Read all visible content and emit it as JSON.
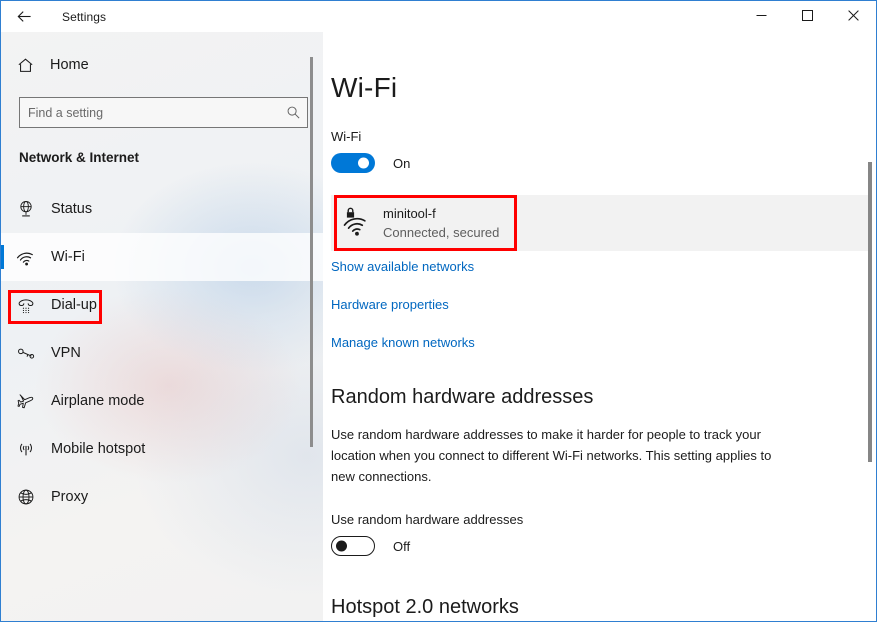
{
  "window": {
    "title": "Settings",
    "back_icon": "back-arrow-icon",
    "controls": {
      "minimize": "minimize-icon",
      "maximize": "maximize-icon",
      "close": "close-icon"
    },
    "border_color": "#2f7fd1"
  },
  "sidebar": {
    "home": {
      "label": "Home",
      "icon": "home-icon"
    },
    "search": {
      "placeholder": "Find a setting",
      "value": "",
      "icon": "search-icon"
    },
    "section_heading": "Network & Internet",
    "items": [
      {
        "label": "Status",
        "icon": "status-globe-icon",
        "selected": false
      },
      {
        "label": "Wi-Fi",
        "icon": "wifi-icon",
        "selected": true
      },
      {
        "label": "Dial-up",
        "icon": "dialup-phone-icon",
        "selected": false
      },
      {
        "label": "VPN",
        "icon": "vpn-key-icon",
        "selected": false
      },
      {
        "label": "Airplane mode",
        "icon": "airplane-icon",
        "selected": false
      },
      {
        "label": "Mobile hotspot",
        "icon": "hotspot-antenna-icon",
        "selected": false
      },
      {
        "label": "Proxy",
        "icon": "proxy-globe-icon",
        "selected": false
      }
    ]
  },
  "main": {
    "page_title": "Wi-Fi",
    "wifi_toggle": {
      "label": "Wi-Fi",
      "state": "On",
      "is_on": true
    },
    "network_card": {
      "name": "minitool-f",
      "status": "Connected, secured",
      "icon": "wifi-secured-icon",
      "annotated": true
    },
    "links": [
      {
        "label": "Show available networks"
      },
      {
        "label": "Hardware properties"
      },
      {
        "label": "Manage known networks"
      }
    ],
    "random_hw": {
      "title": "Random hardware addresses",
      "description": "Use random hardware addresses to make it harder for people to track your location when you connect to different Wi-Fi networks. This setting applies to new connections.",
      "toggle_label": "Use random hardware addresses",
      "state": "Off",
      "is_on": false
    },
    "hotspot": {
      "title": "Hotspot 2.0 networks"
    }
  },
  "annotation": {
    "color": "#ff0000"
  },
  "colors": {
    "accent": "#0078d7",
    "link": "#0067c0",
    "card_bg": "#f2f2f2",
    "text": "#1b1b1b",
    "muted_text": "#5e5e5e"
  }
}
